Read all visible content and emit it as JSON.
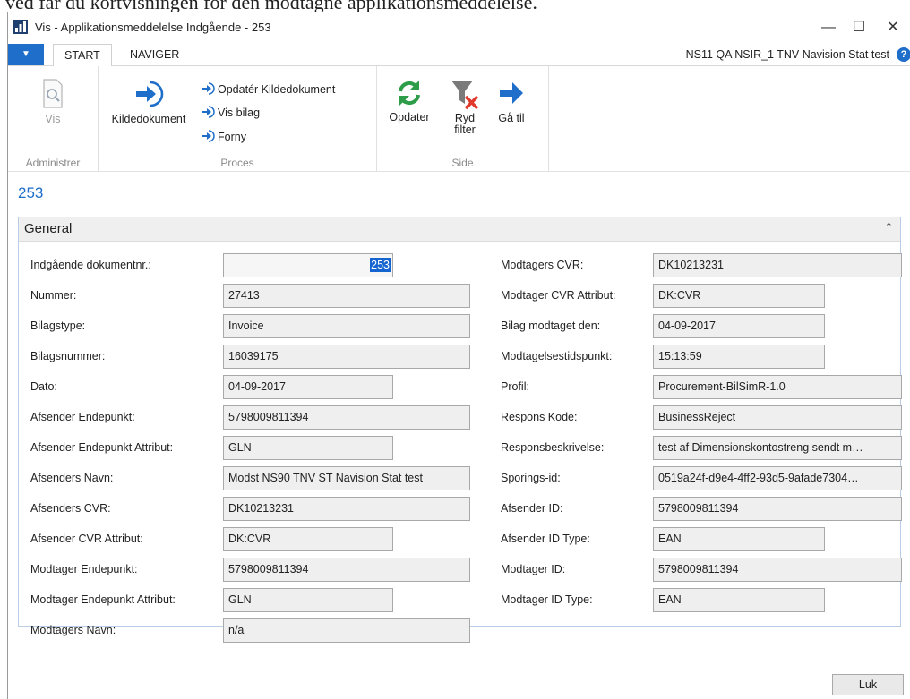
{
  "caption": "ved får du kortvisningen for den modtagne applikationsmeddelelse.",
  "window": {
    "title": "Vis - Applikationsmeddelelse Indgående - 253"
  },
  "menu": {
    "tabs": [
      "START",
      "NAVIGER"
    ],
    "company": "NS11 QA NSIR_1 TNV Navision Stat test"
  },
  "ribbon": {
    "administrer": {
      "label": "Administrer",
      "vis": "Vis"
    },
    "proces": {
      "label": "Proces",
      "kildedokument": "Kildedokument",
      "opdater_kilde": "Opdatér Kildedokument",
      "vis_bilag": "Vis bilag",
      "forny": "Forny"
    },
    "side": {
      "label": "Side",
      "opdater": "Opdater",
      "ryd_filter": "Ryd filter",
      "gaa_til": "Gå til"
    }
  },
  "page_id": "253",
  "panel": {
    "title": "General",
    "left": [
      {
        "label": "Indgående dokumentnr.:",
        "value": "253"
      },
      {
        "label": "Nummer:",
        "value": "27413"
      },
      {
        "label": "Bilagstype:",
        "value": "Invoice"
      },
      {
        "label": "Bilagsnummer:",
        "value": "16039175"
      },
      {
        "label": "Dato:",
        "value": "04-09-2017"
      },
      {
        "label": "Afsender Endepunkt:",
        "value": "5798009811394"
      },
      {
        "label": "Afsender Endepunkt Attribut:",
        "value": "GLN"
      },
      {
        "label": "Afsenders Navn:",
        "value": "Modst NS90 TNV ST Navision Stat test"
      },
      {
        "label": "Afsenders CVR:",
        "value": "DK10213231"
      },
      {
        "label": "Afsender CVR Attribut:",
        "value": "DK:CVR"
      },
      {
        "label": "Modtager Endepunkt:",
        "value": "5798009811394"
      },
      {
        "label": "Modtager Endepunkt Attribut:",
        "value": "GLN"
      },
      {
        "label": "Modtagers Navn:",
        "value": "n/a"
      }
    ],
    "right": [
      {
        "label": "Modtagers CVR:",
        "value": "DK10213231"
      },
      {
        "label": "Modtager CVR Attribut:",
        "value": "DK:CVR"
      },
      {
        "label": "Bilag modtaget den:",
        "value": "04-09-2017"
      },
      {
        "label": "Modtagelsestidspunkt:",
        "value": "15:13:59"
      },
      {
        "label": "Profil:",
        "value": "Procurement-BilSimR-1.0"
      },
      {
        "label": "Respons Kode:",
        "value": "BusinessReject"
      },
      {
        "label": "Responsbeskrivelse:",
        "value": "test af Dimensionskontostreng sendt m…"
      },
      {
        "label": "Sporings-id:",
        "value": "0519a24f-d9e4-4ff2-93d5-9afade7304…"
      },
      {
        "label": "Afsender ID:",
        "value": "5798009811394"
      },
      {
        "label": "Afsender ID Type:",
        "value": "EAN"
      },
      {
        "label": "Modtager ID:",
        "value": "5798009811394"
      },
      {
        "label": "Modtager ID Type:",
        "value": "EAN"
      }
    ]
  },
  "buttons": {
    "close": "Luk"
  }
}
